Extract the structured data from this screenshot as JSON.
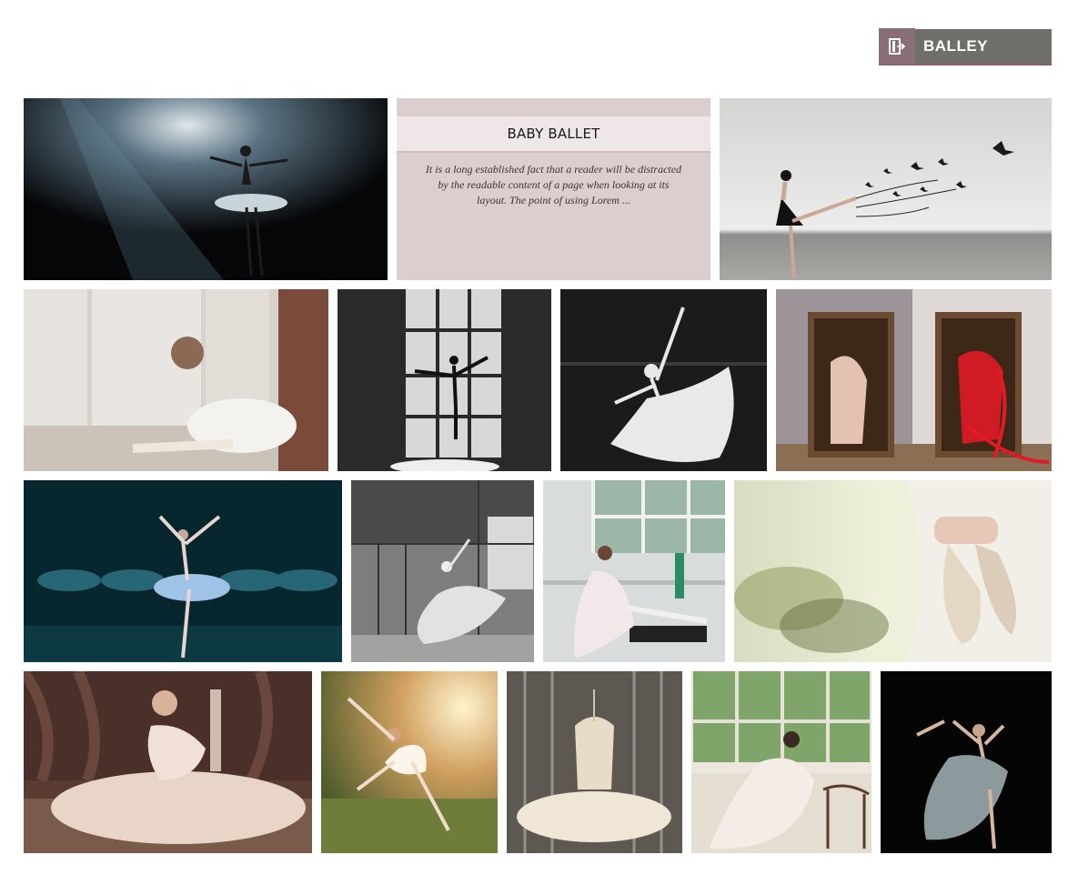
{
  "header": {
    "logout_label": "BALLEY",
    "logout_icon": "door-exit-icon"
  },
  "feature": {
    "title": "BABY BALLET",
    "description": "It is a long established fact that a reader will be distracted by the readable content of a page when looking at its layout. The point of using Lorem ..."
  },
  "colors": {
    "logout_bg": "#6e6e6a",
    "logout_icon_bg": "#8a6e75",
    "feature_bg": "#dccece",
    "feature_bar": "#efe7e7"
  },
  "gallery": [
    {
      "name": "ballerina-spotlight-photo"
    },
    {
      "name": "dancer-with-birds-photo"
    },
    {
      "name": "girl-by-window-photo"
    },
    {
      "name": "dancer-at-window-bw-photo"
    },
    {
      "name": "dancer-white-dress-bw-photo"
    },
    {
      "name": "pointe-shoes-in-boxes-photo"
    },
    {
      "name": "ballerina-on-stage-blue-photo"
    },
    {
      "name": "dancer-in-loft-bw-photo"
    },
    {
      "name": "dancer-at-barre-photo"
    },
    {
      "name": "hands-holding-ballet-shoes-photo"
    },
    {
      "name": "dancer-seated-tulle-photo"
    },
    {
      "name": "dancer-leaping-sunset-photo"
    },
    {
      "name": "tutu-on-hanger-photo"
    },
    {
      "name": "dancer-at-chair-photo"
    },
    {
      "name": "dancer-black-background-photo"
    }
  ]
}
